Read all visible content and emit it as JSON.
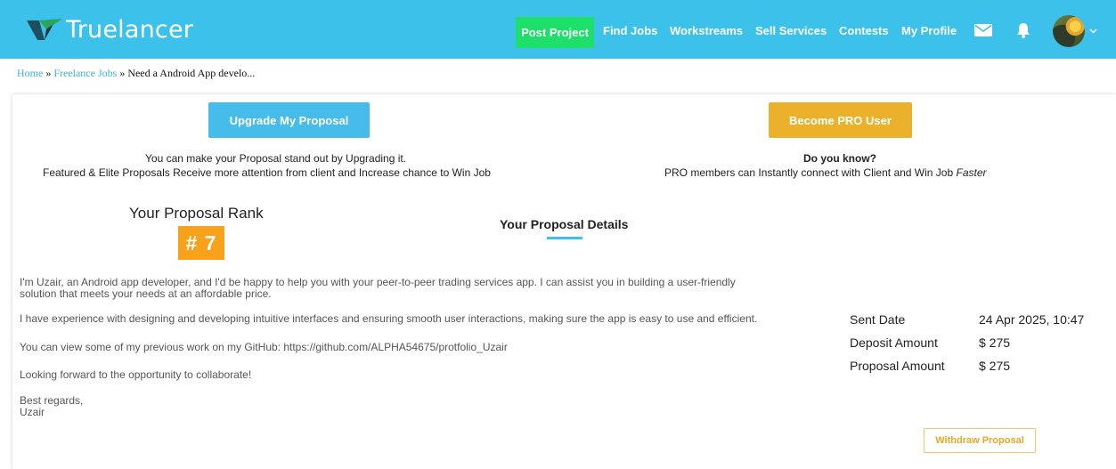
{
  "header": {
    "logo_text": "Truelancer",
    "nav": {
      "post_project": "Post Project",
      "find_jobs": "Find Jobs",
      "workstreams": "Workstreams",
      "sell_services": "Sell Services",
      "contests": "Contests",
      "my_profile": "My Profile"
    }
  },
  "breadcrumb": {
    "home": "Home",
    "sep": " » ",
    "freelance_jobs": "Freelance Jobs",
    "current": "Need a Android App develo..."
  },
  "promo": {
    "upgrade_label": "Upgrade My Proposal",
    "upgrade_line1": "You can make your Proposal stand out by Upgrading it.",
    "upgrade_line2": "Featured & Elite Proposals Receive more attention from client and Increase chance to Win Job",
    "pro_label": "Become PRO User",
    "pro_heading": "Do you know?",
    "pro_line": "PRO members can Instantly connect with Client and Win Job",
    "pro_line_em": "Faster"
  },
  "rank": {
    "title": "Your Proposal Rank",
    "value": "# 7"
  },
  "details": {
    "title": "Your Proposal Details",
    "paragraphs": [
      "I'm Uzair, an Android app developer, and I'd be happy to help you with your peer-to-peer trading services app. I can assist you in building a user-friendly",
      "solution that meets your needs at an affordable price.",
      "I have experience with designing and developing intuitive interfaces and ensuring smooth user interactions, making sure the app is easy to use and efficient.",
      "You can view some of my previous work on my GitHub: https://github.com/ALPHA54675/protfolio_Uzair",
      "Looking forward to the opportunity to collaborate!",
      "Best regards,",
      "Uzair"
    ]
  },
  "meta": {
    "sent_date_label": "Sent Date",
    "sent_date_value": "24 Apr 2025, 10:47",
    "deposit_label": "Deposit Amount",
    "deposit_value": "$ 275",
    "proposal_label": "Proposal Amount",
    "proposal_value": "$ 275"
  },
  "actions": {
    "withdraw_label": "Withdraw Proposal"
  },
  "colors": {
    "header_bg": "#3cc1ea",
    "post_project_bg": "#1ce06a",
    "upgrade_bg": "#45bce9",
    "pro_bg": "#ecb12b",
    "rank_badge_bg": "#f8a11b",
    "withdraw_border": "#f2c96a"
  },
  "icons": {
    "logo": "truelancer-logo-icon",
    "mail": "mail-icon",
    "bell": "bell-icon",
    "chevron": "chevron-down-icon"
  }
}
